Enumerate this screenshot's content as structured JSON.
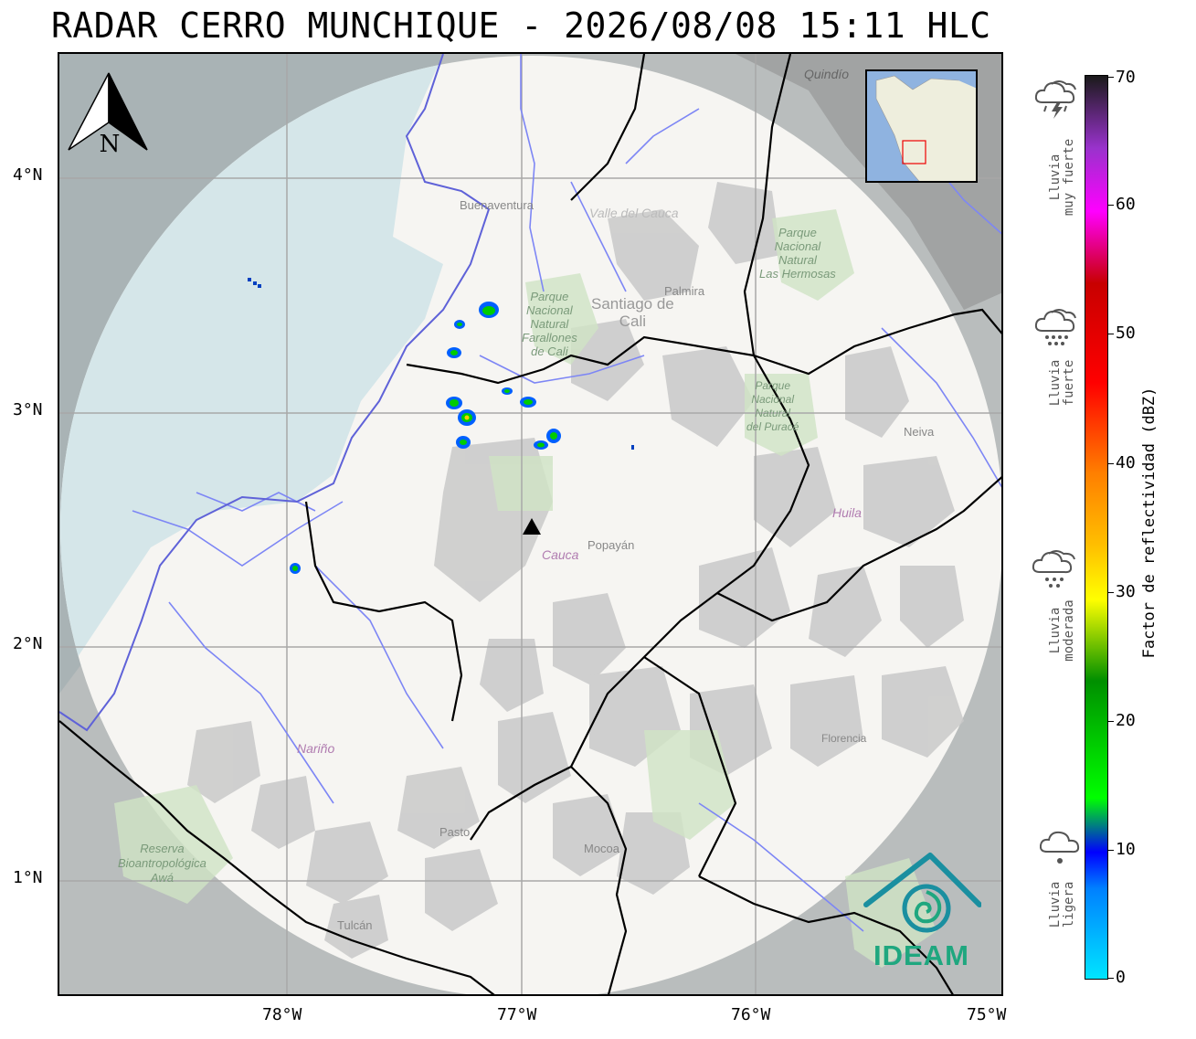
{
  "title": "RADAR CERRO MUNCHIQUE - 2026/08/08 15:11 HLC",
  "latitude_labels": [
    "4°N",
    "3°N",
    "2°N",
    "1°N"
  ],
  "longitude_labels": [
    "78°W",
    "77°W",
    "76°W",
    "75°W"
  ],
  "colorbar": {
    "title": "Factor de reflectividad (dBZ)",
    "ticks": [
      "70",
      "60",
      "50",
      "40",
      "30",
      "20",
      "10",
      "0"
    ]
  },
  "rain_categories": [
    {
      "line1": "Lluvia",
      "line2": "muy fuerte",
      "icon": "thunderstorm-cloud-icon"
    },
    {
      "line1": "Lluvia",
      "line2": "fuerte",
      "icon": "heavy-rain-cloud-icon"
    },
    {
      "line1": "Lluvia",
      "line2": "moderada",
      "icon": "moderate-rain-cloud-icon"
    },
    {
      "line1": "Lluvia",
      "line2": "ligera",
      "icon": "light-rain-cloud-icon"
    }
  ],
  "map_labels": {
    "buenaventura": "Buenaventura",
    "valle": "Valle del Cauca",
    "quindio": "Quindío",
    "pnn_farallones": "Parque\nNacional\nNatural\nFarallones\nde Cali",
    "santiago_de_cali": "Santiago de\nCali",
    "palmira": "Palmira",
    "pnn_hermosas": "Parque\nNacional\nNatural\nLas Hermosas",
    "pnn_purace": "Parque\nNacional\nNatural\ndel Puracé",
    "neiva": "Neiva",
    "huila": "Huila",
    "cauca": "Cauca",
    "popayan": "Popayán",
    "narino": "Nariño",
    "florencia": "Florencia",
    "pasto": "Pasto",
    "mocoa": "Mocoa",
    "tulcan": "Tulcán",
    "reserva": "Reserva\nBioantropológica\nAwá"
  },
  "north_arrow_label": "N",
  "logo_text": "IDEAM",
  "colors": {
    "sea": "#cde0e6",
    "land": "#f6f5f2",
    "outside_coverage": "#a8a8a8",
    "rivers": "#7d86f5",
    "border": "#000000",
    "logo": "#1fa77f"
  }
}
